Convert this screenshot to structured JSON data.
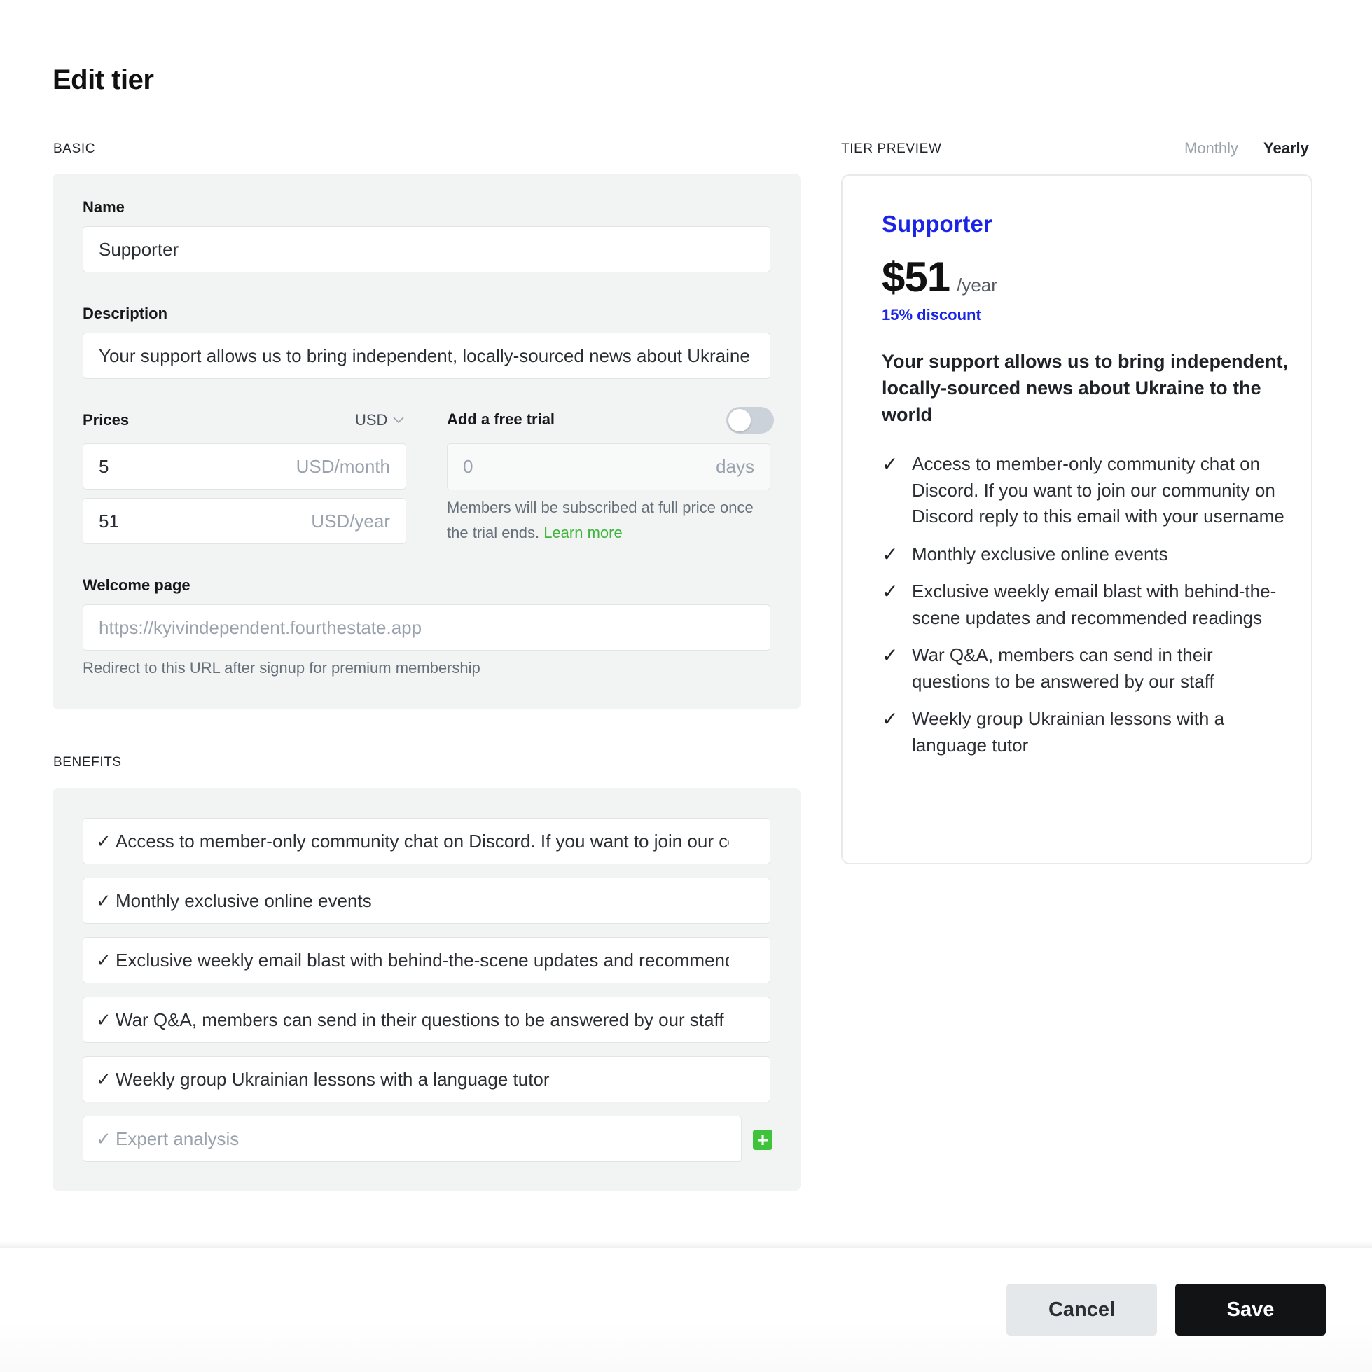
{
  "page": {
    "title": "Edit tier"
  },
  "basic": {
    "section_label": "BASIC",
    "name": {
      "label": "Name",
      "value": "Supporter"
    },
    "description": {
      "label": "Description",
      "value": "Your support allows us to bring independent, locally-sourced news about Ukraine to the world"
    },
    "prices": {
      "label": "Prices",
      "currency": "USD",
      "monthly": {
        "value": "5",
        "suffix": "USD/month"
      },
      "yearly": {
        "value": "51",
        "suffix": "USD/year"
      }
    },
    "free_trial": {
      "label": "Add a free trial",
      "enabled": false,
      "days_value": "0",
      "days_suffix": "days",
      "help_text": "Members will be subscribed at full price once the trial ends.",
      "learn_more": "Learn more"
    },
    "welcome_page": {
      "label": "Welcome page",
      "placeholder": "https://kyivindependent.fourthestate.app",
      "help_text": "Redirect to this URL after signup for premium membership"
    }
  },
  "benefits": {
    "section_label": "BENEFITS",
    "items": [
      "Access to member-only community chat on Discord. If you want to join our community on Discord reply to this email with your username",
      "Monthly exclusive online events",
      "Exclusive weekly email blast with behind-the-scene updates and recommended readings",
      "War Q&A, members can send in their questions to be answered by our staff",
      "Weekly group Ukrainian lessons with a language tutor"
    ],
    "new_item_placeholder": "Expert analysis",
    "check_glyph": "✓",
    "add_glyph": "+"
  },
  "preview": {
    "section_label": "TIER PREVIEW",
    "period_options": [
      "Monthly",
      "Yearly"
    ],
    "selected_period": "Yearly",
    "name": "Supporter",
    "price": "$51",
    "period": "/year",
    "discount": "15% discount",
    "description": "Your support allows us to bring independent, locally-sourced news about Ukraine to the world",
    "benefits": [
      "Access to member-only community chat on Discord. If you want to join our community on Discord reply to this email with your username",
      "Monthly exclusive online events",
      "Exclusive weekly email blast with behind-the-scene updates and recommended readings",
      "War Q&A, members can send in their questions to be answered by our staff",
      "Weekly group Ukrainian lessons with a language tutor"
    ]
  },
  "footer": {
    "cancel_label": "Cancel",
    "save_label": "Save"
  },
  "colors": {
    "accent_blue": "#1a24e6",
    "success_green": "#3ec33a",
    "link_green": "#3cb539",
    "primary_button": "#121314"
  }
}
